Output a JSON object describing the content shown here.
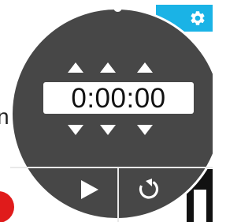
{
  "background": {
    "partial_text": "n"
  },
  "timer": {
    "display": "0:00:00",
    "adjust_controls": {
      "hours_up": "increase-hours",
      "minutes_up": "increase-minutes",
      "seconds_up": "increase-seconds",
      "hours_down": "decrease-hours",
      "minutes_down": "decrease-minutes",
      "seconds_down": "decrease-seconds"
    },
    "buttons": {
      "start": "play-icon",
      "reset": "reset-icon"
    }
  },
  "settings": {
    "icon": "gear-icon"
  },
  "colors": {
    "face": "#474747",
    "display_bg": "#ffffff",
    "settings_accent": "#1ab3e6"
  }
}
